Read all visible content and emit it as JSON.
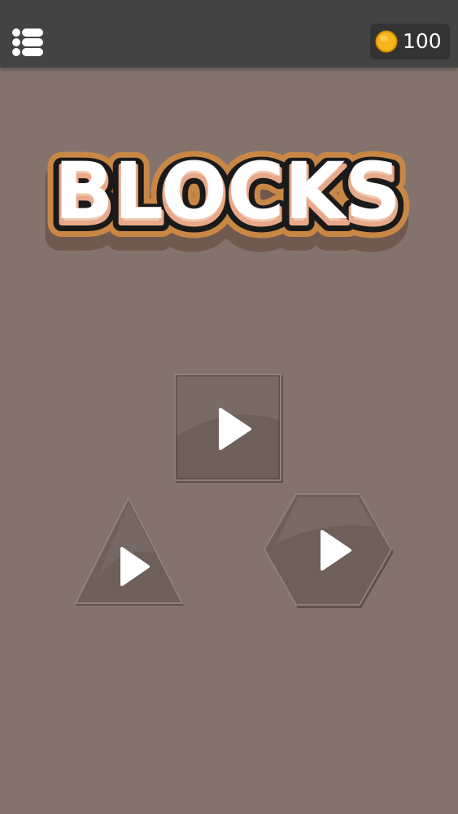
{
  "header": {
    "menu_icon": "menu-list-icon",
    "coins": {
      "icon": "coin-icon",
      "count": "100"
    }
  },
  "logo": {
    "text": "BLOCKS"
  },
  "modes": [
    {
      "shape": "square",
      "icon": "play-icon"
    },
    {
      "shape": "triangle",
      "icon": "play-icon"
    },
    {
      "shape": "hexagon",
      "icon": "play-icon"
    }
  ],
  "colors": {
    "background": "#84736d",
    "topbar": "#434343",
    "coin_box": "#333333",
    "coin": "#f5b820",
    "logo_fill": "#ffffff",
    "logo_outline": "#1a1a1a",
    "logo_glow": "#c98746",
    "tile_fill": "#6e5f59"
  }
}
